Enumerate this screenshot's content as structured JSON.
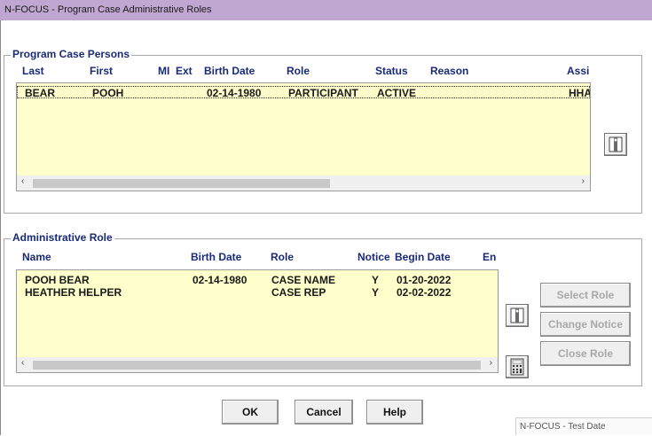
{
  "window": {
    "title": "N-FOCUS - Program Case Administrative Roles"
  },
  "program_case_persons": {
    "title": "Program Case Persons",
    "columns": [
      "Last",
      "First",
      "MI",
      "Ext",
      "Birth Date",
      "Role",
      "Status",
      "Reason",
      "Assi"
    ],
    "rows": [
      {
        "last": "BEAR",
        "first": "POOH",
        "mi": "",
        "ext": "",
        "birth_date": "02-14-1980",
        "role": "PARTICIPANT",
        "status": "ACTIVE",
        "reason": "",
        "assi": "HHA"
      }
    ],
    "scroll_left": "‹",
    "scroll_right": "›"
  },
  "administrative_role": {
    "title": "Administrative Role",
    "columns": [
      "Name",
      "Birth Date",
      "Role",
      "Notice",
      "Begin Date",
      "En"
    ],
    "rows": [
      {
        "name": "POOH BEAR",
        "birth_date": "02-14-1980",
        "role": "CASE NAME",
        "notice": "Y",
        "begin_date": "01-20-2022"
      },
      {
        "name": "HEATHER HELPER",
        "birth_date": "",
        "role": "CASE REP",
        "notice": "Y",
        "begin_date": "02-02-2022"
      }
    ],
    "scroll_left": "‹",
    "scroll_right": "›",
    "buttons": {
      "select_role": "Select Role",
      "change_notice": "Change Notice",
      "close_role": "Close Role"
    }
  },
  "footer": {
    "ok": "OK",
    "cancel": "Cancel",
    "help": "Help"
  },
  "watermark": "N-FOCUS - Test Date"
}
